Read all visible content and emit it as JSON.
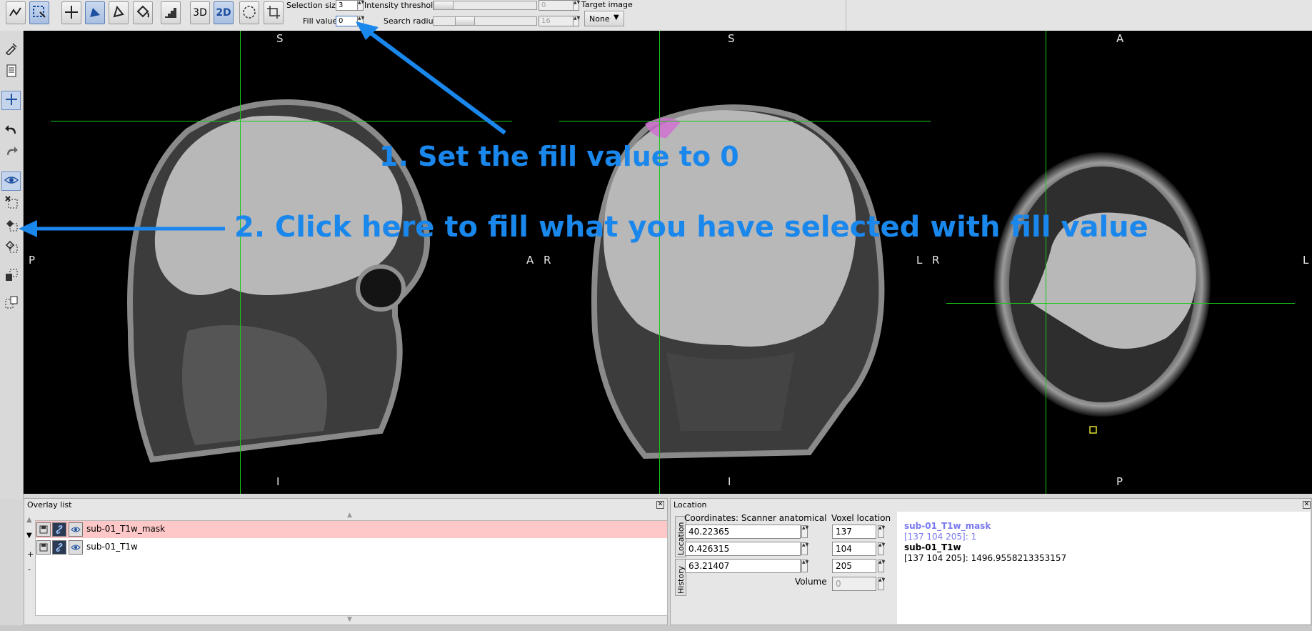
{
  "toolbar": {
    "view_3d_label": "3D",
    "view_2d_label": "2D",
    "selection_size_label": "Selection size",
    "selection_size_value": "3",
    "fill_value_label": "Fill value",
    "fill_value_value": "0",
    "intensity_threshold_label": "Intensity threshold",
    "intensity_threshold_value": "0",
    "search_radius_label": "Search radius",
    "search_radius_value": "16",
    "target_image_label": "Target image",
    "target_image_value": "None"
  },
  "viewer": {
    "sagittal": {
      "top": "S",
      "bottom": "I",
      "left": "P",
      "right": "A"
    },
    "coronal": {
      "top": "S",
      "bottom": "I",
      "left": "R",
      "right": "L"
    },
    "axial": {
      "top": "A",
      "bottom": "P",
      "left": "R",
      "right": "L"
    }
  },
  "annotations": {
    "step1": "1. Set the fill value to 0",
    "step2": "2. Click here to fill what you have selected with fill value"
  },
  "overlay_list": {
    "title": "Overlay list",
    "items": [
      {
        "name": "sub-01_T1w_mask",
        "selected": true
      },
      {
        "name": "sub-01_T1w",
        "selected": false
      }
    ],
    "add_label": "+",
    "remove_label": "-"
  },
  "location": {
    "title": "Location",
    "coords_label": "Coordinates: Scanner anatomical",
    "voxel_label": "Voxel location",
    "coords": [
      "40.22365",
      "0.426315",
      "63.21407"
    ],
    "voxels": [
      "137",
      "104",
      "205"
    ],
    "volume_label": "Volume",
    "volume_value": "0",
    "tab_location": "Location",
    "tab_history": "History",
    "info": [
      {
        "name": "sub-01_T1w_mask",
        "value": "[137 104 205]: 1"
      },
      {
        "name": "sub-01_T1w",
        "value": "[137 104 205]: 1496.9558213353157"
      }
    ]
  },
  "colors": {
    "annotation_blue": "#1a87ec",
    "crosshair_green": "#19c819",
    "selected_row": "#ffc8c8",
    "mask_link": "#7878f0"
  }
}
